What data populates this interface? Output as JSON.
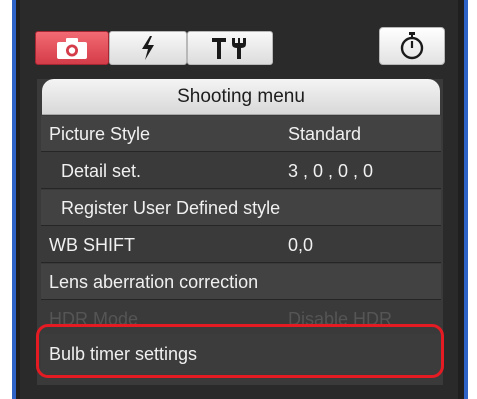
{
  "tabs": [
    {
      "name": "shooting",
      "icon": "camera-icon",
      "active": true
    },
    {
      "name": "flash",
      "icon": "flash-icon",
      "active": false
    },
    {
      "name": "settings",
      "icon": "tools-icon",
      "active": false
    },
    {
      "name": "timer",
      "icon": "stopwatch-icon",
      "active": false
    }
  ],
  "colors": {
    "active_tab": "#d94a55",
    "highlight_ring": "#e51b24",
    "window_border": "#2d62c7"
  },
  "menu": {
    "title": "Shooting menu",
    "items": [
      {
        "label": "Picture Style",
        "value": "Standard"
      },
      {
        "label": "Detail set.",
        "value": "3 , 0 , 0 , 0"
      },
      {
        "label": "Register User Defined style",
        "value": ""
      },
      {
        "label": "WB SHIFT",
        "value": "0,0"
      },
      {
        "label": "Lens aberration correction",
        "value": ""
      },
      {
        "label": "HDR Mode",
        "value": "Disable HDR"
      },
      {
        "label": "Bulb timer settings",
        "value": ""
      }
    ]
  }
}
